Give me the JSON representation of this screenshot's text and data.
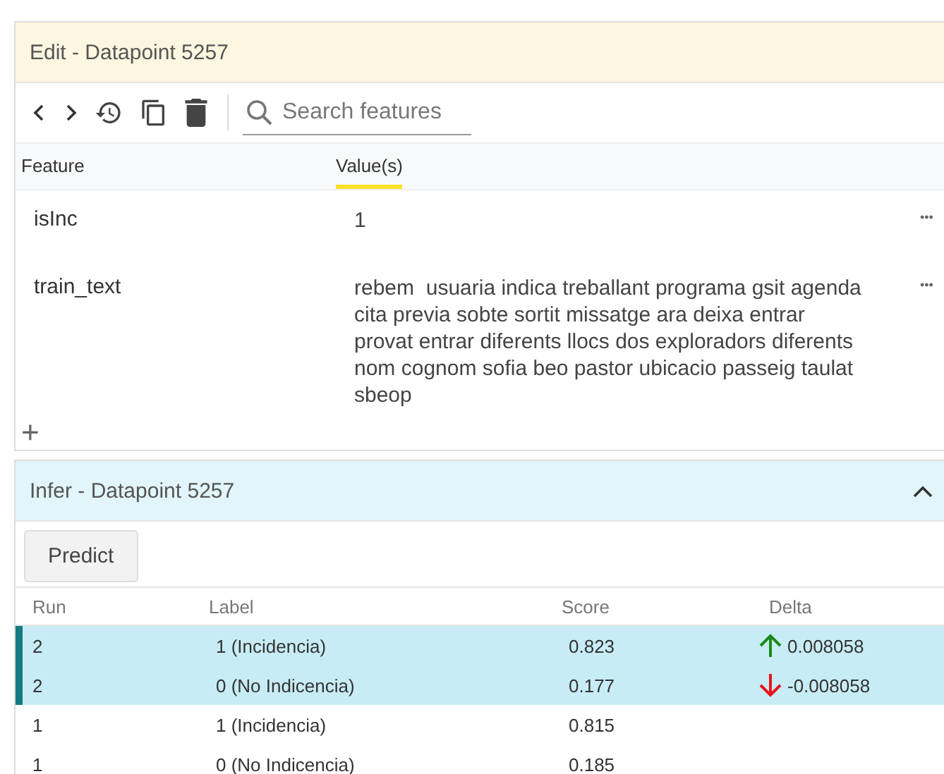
{
  "edit_panel": {
    "title": "Edit - Datapoint 5257",
    "search": {
      "placeholder": "Search features"
    },
    "columns": [
      {
        "label": "Feature",
        "selected": false
      },
      {
        "label": "Value(s)",
        "selected": true
      }
    ],
    "rows": [
      {
        "feature": "isInc",
        "value": "1",
        "menu": "•••"
      },
      {
        "feature": "train_text",
        "value": "rebem  usuaria indica treballant programa gsit agenda cita previa sobte sortit missatge ara deixa entrar provat entrar diferents llocs dos exploradors diferents nom cognom sofia beo pastor ubicacio passeig taulat sbeop",
        "menu": "•••"
      }
    ],
    "add": "+"
  },
  "infer_panel": {
    "title": "Infer - Datapoint 5257",
    "expanded": true,
    "button": "Predict",
    "columns": [
      "Run",
      "Label",
      "Score",
      "Delta"
    ],
    "rows": [
      {
        "run": "2",
        "label": "1 (Incidencia)",
        "score": "0.823",
        "delta": "0.008058",
        "kind": "up",
        "selected": true
      },
      {
        "run": "2",
        "label": "0 (No Indicencia)",
        "score": "0.177",
        "delta": "-0.008058",
        "kind": "down",
        "selected": true
      },
      {
        "run": "1",
        "label": "1 (Incidencia)",
        "score": "0.815",
        "selected": false
      },
      {
        "run": "1",
        "label": "0 (No Indicencia)",
        "score": "0.185",
        "selected": false
      }
    ]
  }
}
